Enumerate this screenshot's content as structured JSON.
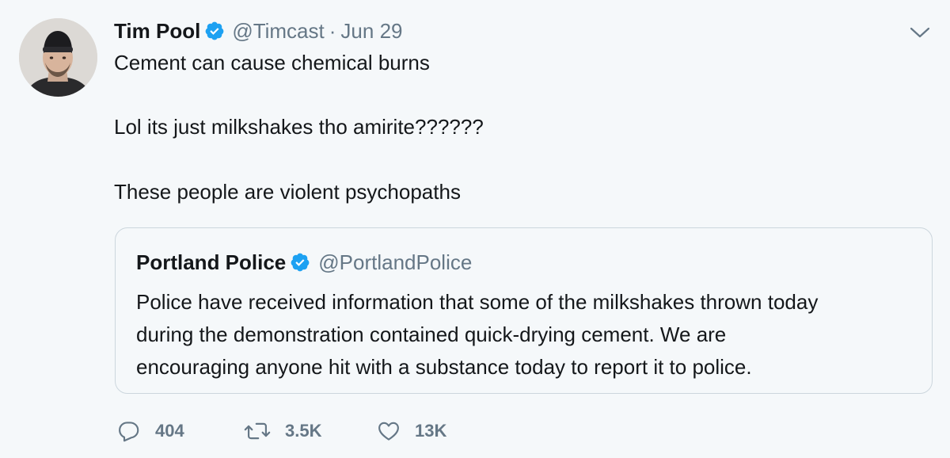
{
  "tweet": {
    "author_name": "Tim Pool",
    "handle": "@Timcast",
    "separator": "·",
    "date": "Jun 29",
    "lines": [
      "Cement can cause chemical burns",
      "Lol its just milkshakes tho amirite??????",
      "These people are violent psychopaths"
    ]
  },
  "quoted": {
    "author_name": "Portland Police",
    "handle": "@PortlandPolice",
    "lines": [
      "Police have received information that some of the milkshakes thrown today",
      "during the demonstration contained quick-drying cement. We are",
      "encouraging anyone hit with a substance today to report it to police."
    ]
  },
  "actions": {
    "replies": "404",
    "retweets": "3.5K",
    "likes": "13K"
  },
  "icons": {
    "verified": "verified-badge-icon",
    "menu": "chevron-down-icon",
    "reply": "reply-icon",
    "retweet": "retweet-icon",
    "like": "heart-icon"
  },
  "colors": {
    "background": "#f5f8fa",
    "text": "#14171a",
    "muted": "#657786",
    "verified": "#1da1f2",
    "border": "#ccd6dd"
  }
}
